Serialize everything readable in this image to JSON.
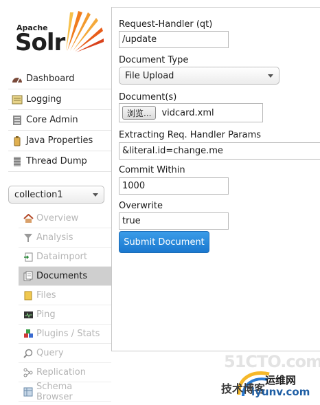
{
  "logo": {
    "apache": "Apache",
    "solr": "Solr"
  },
  "main_menu": [
    {
      "label": "Dashboard",
      "icon": "dashboard-icon"
    },
    {
      "label": "Logging",
      "icon": "logging-icon"
    },
    {
      "label": "Core Admin",
      "icon": "core-admin-icon"
    },
    {
      "label": "Java Properties",
      "icon": "java-properties-icon"
    },
    {
      "label": "Thread Dump",
      "icon": "thread-dump-icon"
    }
  ],
  "core_selector": {
    "value": "collection1"
  },
  "core_menu": [
    {
      "label": "Overview",
      "icon": "home-icon"
    },
    {
      "label": "Analysis",
      "icon": "funnel-icon"
    },
    {
      "label": "Dataimport",
      "icon": "import-icon"
    },
    {
      "label": "Documents",
      "icon": "documents-icon",
      "active": true
    },
    {
      "label": "Files",
      "icon": "folder-icon"
    },
    {
      "label": "Ping",
      "icon": "ping-icon"
    },
    {
      "label": "Plugins / Stats",
      "icon": "plugins-icon"
    },
    {
      "label": "Query",
      "icon": "query-icon"
    },
    {
      "label": "Replication",
      "icon": "replication-icon"
    },
    {
      "label": "Schema Browser",
      "icon": "schema-icon"
    }
  ],
  "form": {
    "request_handler_label": "Request-Handler (qt)",
    "request_handler_value": "/update",
    "document_type_label": "Document Type",
    "document_type_value": "File Upload",
    "documents_label": "Document(s)",
    "browse_label": "浏览...",
    "file_name": "vidcard.xml",
    "extracting_label": "Extracting Req. Handler Params",
    "extracting_value": "&literal.id=change.me",
    "commit_within_label": "Commit Within",
    "commit_within_value": "1000",
    "overwrite_label": "Overwrite",
    "overwrite_value": "true",
    "submit_label": "Submit Document"
  },
  "watermark": {
    "site": "51CTO.com",
    "tag": "运维网",
    "blog": "技术博客",
    "domain": "iyunv.com"
  },
  "colors": {
    "accent": "#1a78cf",
    "active_bg": "#cfcfcf",
    "disabled_text": "#b5b5b5"
  }
}
